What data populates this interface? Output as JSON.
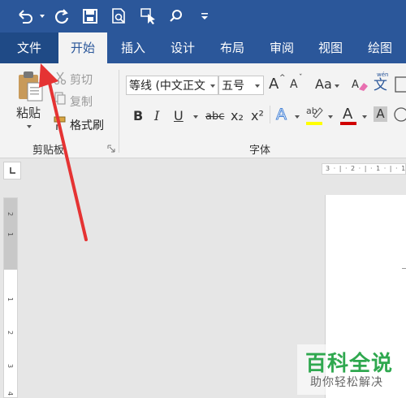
{
  "tabs": {
    "file": "文件",
    "home": "开始",
    "insert": "插入",
    "design": "设计",
    "layout": "布局",
    "review": "审阅",
    "view": "视图",
    "draw": "绘图"
  },
  "clipboard": {
    "paste": "粘贴",
    "cut": "剪切",
    "copy": "复制",
    "format_painter": "格式刷",
    "group_label": "剪贴板"
  },
  "font": {
    "font_name": "等线 (中文正文",
    "font_size": "五号",
    "group_label": "字体",
    "bold": "B",
    "italic": "I",
    "underline": "U",
    "strike": "abc",
    "subscript": "x₂",
    "superscript": "x²",
    "change_case": "Aa",
    "grow": "A",
    "shrink": "A",
    "text_effects": "A",
    "font_color": "A",
    "char_shading": "A",
    "highlight_text": "ab",
    "phonetic": "文"
  },
  "ruler": {
    "horizontal_marks": "3 · | · 2 · | · 1 · | · 1",
    "vertical_marks": [
      "2",
      "1",
      "1",
      "2",
      "3",
      "4"
    ]
  },
  "watermark": {
    "title": "百科全说",
    "subtitle": "助你轻松解决"
  },
  "colors": {
    "accent": "#2b579a",
    "arrow": "#e53333",
    "font_color_bar": "#d00000",
    "highlight_bar": "#ffff00"
  }
}
